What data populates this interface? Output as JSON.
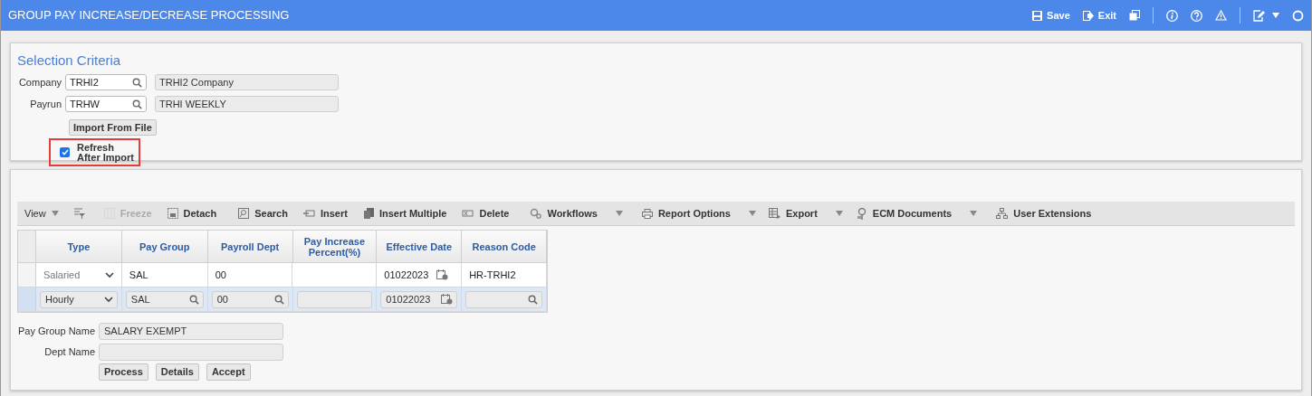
{
  "header": {
    "title": "GROUP PAY INCREASE/DECREASE PROCESSING",
    "actions": [
      {
        "label": "Save"
      },
      {
        "label": "Exit"
      }
    ]
  },
  "selection": {
    "title": "Selection Criteria",
    "fields": [
      {
        "label": "Company",
        "value": "TRHI2",
        "description": "TRHI2 Company"
      },
      {
        "label": "Payrun",
        "value": "TRHW",
        "description": "TRHI WEEKLY"
      }
    ],
    "import_button": "Import From File",
    "refresh_checkbox": {
      "label": "Refresh After Import",
      "checked": true
    }
  },
  "toolbar": [
    {
      "label": "View",
      "disabled": false,
      "dropdown": true
    },
    {
      "disabled": false,
      "dropdown": false
    },
    {
      "label": "Freeze",
      "disabled": true,
      "dropdown": false
    },
    {
      "label": "Detach",
      "disabled": false,
      "dropdown": false
    },
    {
      "label": "Search",
      "disabled": false,
      "dropdown": false
    },
    {
      "label": "Insert",
      "disabled": false,
      "dropdown": false
    },
    {
      "label": "Insert Multiple",
      "disabled": false,
      "dropdown": false
    },
    {
      "label": "Delete",
      "disabled": false,
      "dropdown": false
    },
    {
      "label": "Workflows",
      "disabled": false,
      "dropdown": true
    },
    {
      "label": "Report Options",
      "disabled": false,
      "dropdown": true
    },
    {
      "label": "Export",
      "disabled": false,
      "dropdown": true
    },
    {
      "label": "ECM Documents",
      "disabled": false,
      "dropdown": true
    },
    {
      "label": "User Extensions",
      "disabled": false,
      "dropdown": false
    }
  ],
  "table": {
    "columns": [
      "Type",
      "Pay Group",
      "Payroll Dept",
      "Pay Increase Percent(%)",
      "Effective Date",
      "Reason Code"
    ],
    "rows": [
      {
        "selected": false,
        "type": "Salaried",
        "pay_group": "SAL",
        "payroll_dept": "00",
        "effective_date": "01022023",
        "reason_code": "HR-TRHI2"
      },
      {
        "selected": true,
        "type": "Hourly",
        "pay_group": "SAL",
        "payroll_dept": "00",
        "effective_date": "01022023"
      }
    ]
  },
  "details": {
    "fields": [
      {
        "label": "Pay Group Name",
        "value": "SALARY EXEMPT"
      },
      {
        "label": "Dept Name"
      }
    ],
    "buttons": [
      "Process",
      "Details",
      "Accept"
    ]
  }
}
